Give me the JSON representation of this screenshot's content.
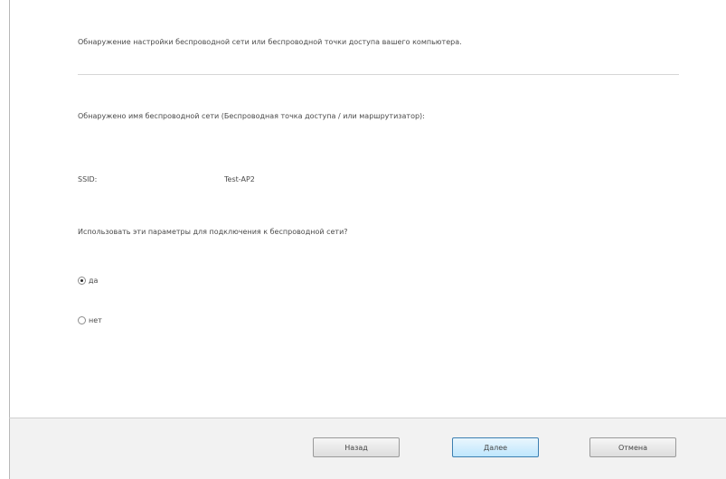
{
  "dialog": {
    "intro_text": "Обнаружение настройки беспроводной сети или беспроводной точки доступа вашего компьютера.",
    "detected_label": "Обнаружено имя беспроводной сети (Беспроводная точка доступа / или маршрутизатор):",
    "ssid_label": "SSID:",
    "ssid_value": "Test-AP2",
    "question": "Использовать эти параметры для подключения к беспроводной сети?",
    "options": [
      {
        "label": "да",
        "selected": true
      },
      {
        "label": "нет",
        "selected": false
      }
    ]
  },
  "buttons": {
    "back": "Назад",
    "next": "Далее",
    "cancel": "Отмена"
  }
}
